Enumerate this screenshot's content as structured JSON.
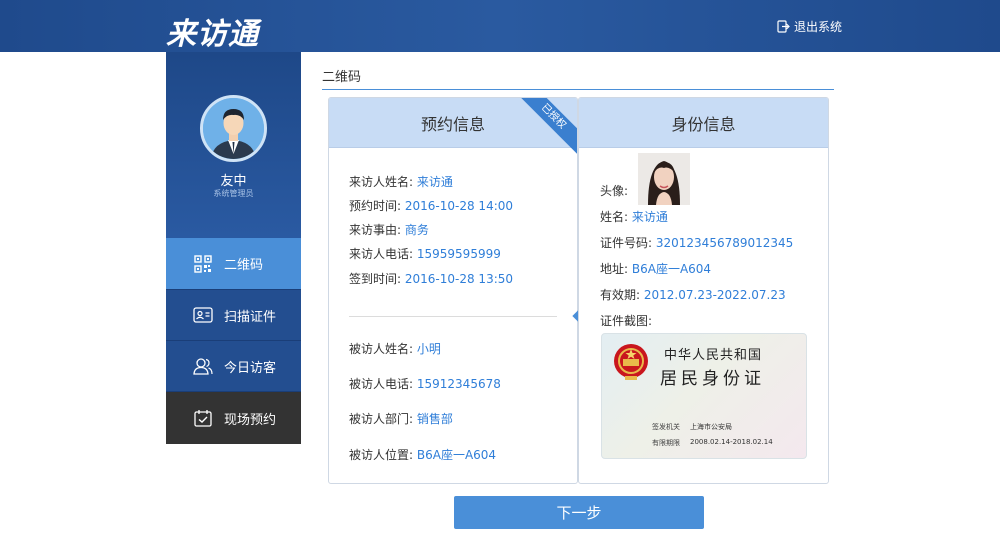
{
  "header": {
    "logo": "来访通",
    "logout_label": "退出系统"
  },
  "sidebar": {
    "user_name": "友中",
    "user_role": "系统管理员",
    "items": [
      {
        "label": "二维码",
        "active": true
      },
      {
        "label": "扫描证件"
      },
      {
        "label": "今日访客"
      },
      {
        "label": "现场预约"
      }
    ]
  },
  "section": {
    "title": "二维码"
  },
  "reservation": {
    "title": "预约信息",
    "badge": "已授权",
    "visitor": [
      {
        "label": "来访人姓名:",
        "value": "来访通"
      },
      {
        "label": "预约时间:",
        "value": "2016-10-28 14:00"
      },
      {
        "label": "来访事由:",
        "value": "商务"
      },
      {
        "label": "来访人电话:",
        "value": "15959595999"
      },
      {
        "label": "签到时间:",
        "value": "2016-10-28 13:50"
      }
    ],
    "host": [
      {
        "label": "被访人姓名:",
        "value": "小明"
      },
      {
        "label": "被访人电话:",
        "value": "15912345678"
      },
      {
        "label": "被访人部门:",
        "value": "销售部"
      },
      {
        "label": "被访人位置:",
        "value": "B6A座一A604"
      }
    ]
  },
  "identity": {
    "title": "身份信息",
    "avatar_label": "头像:",
    "fields": [
      {
        "label": "姓名:",
        "value": "来访通"
      },
      {
        "label": "证件号码:",
        "value": "320123456789012345"
      },
      {
        "label": "地址:",
        "value": "B6A座一A604"
      },
      {
        "label": "有效期:",
        "value": "2012.07.23-2022.07.23"
      }
    ],
    "screenshot_label": "证件截图:",
    "card": {
      "country": "中华人民共和国",
      "title": "居民身份证",
      "authority_label": "签发机关",
      "authority_value": "上海市公安局",
      "validity_label": "有限期限",
      "validity_value": "2008.02.14-2018.02.14"
    }
  },
  "actions": {
    "next_label": "下一步"
  },
  "colors": {
    "header_bg": "#1f4a8c",
    "accent": "#4a8fd8",
    "value_text": "#2f7ed8",
    "panel_head_bg": "#c8dcf5"
  }
}
